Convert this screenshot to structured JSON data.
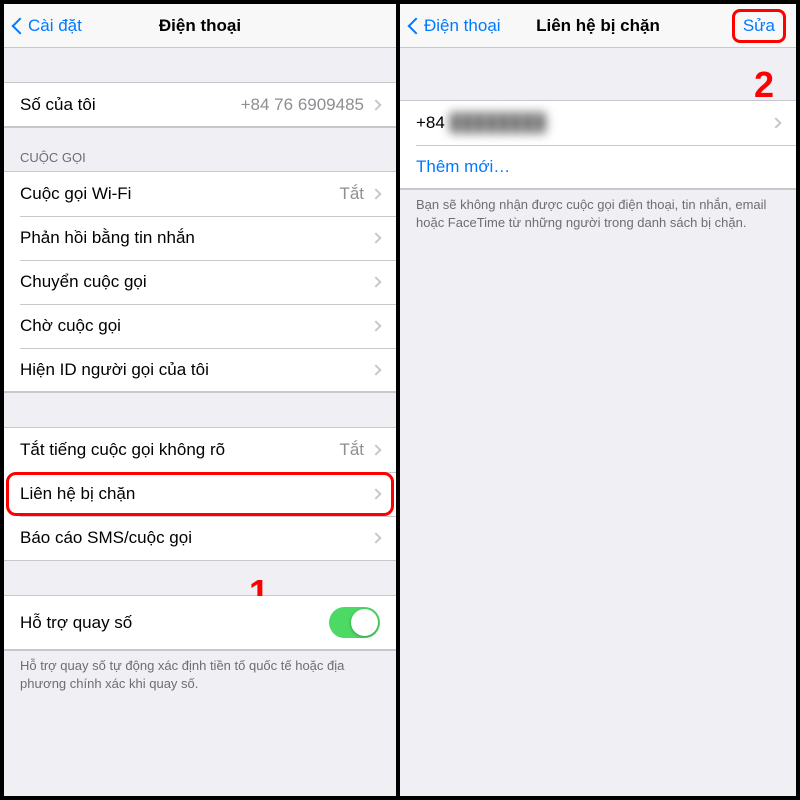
{
  "left": {
    "nav": {
      "back": "Cài đặt",
      "title": "Điện thoại"
    },
    "my_number": {
      "label": "Số của tôi",
      "value": "+84 76 6909485"
    },
    "calls_header": "CUỘC GỌI",
    "calls": {
      "wifi": {
        "label": "Cuộc gọi Wi-Fi",
        "status": "Tắt"
      },
      "respond": {
        "label": "Phản hồi bằng tin nhắn"
      },
      "forward": {
        "label": "Chuyển cuộc gọi"
      },
      "waiting": {
        "label": "Chờ cuộc gọi"
      },
      "callerid": {
        "label": "Hiện ID người gọi của tôi"
      }
    },
    "misc": {
      "silence": {
        "label": "Tắt tiếng cuộc gọi không rõ",
        "status": "Tắt"
      },
      "blocked": {
        "label": "Liên hệ bị chặn"
      },
      "report": {
        "label": "Báo cáo SMS/cuộc gọi"
      }
    },
    "dial_assist": {
      "label": "Hỗ trợ quay số"
    },
    "dial_footer": "Hỗ trợ quay số tự động xác định tiền tố quốc tế hoặc địa phương chính xác khi quay số.",
    "annot": "1"
  },
  "right": {
    "nav": {
      "back": "Điện thoại",
      "title": "Liên hệ bị chặn",
      "action": "Sửa"
    },
    "contact_prefix": "+84",
    "contact_blur": "████████",
    "add_new": "Thêm mới…",
    "footer": "Bạn sẽ không nhận được cuộc gọi điện thoại, tin nhắn, email hoặc FaceTime từ những người trong danh sách bị chặn.",
    "annot": "2"
  }
}
